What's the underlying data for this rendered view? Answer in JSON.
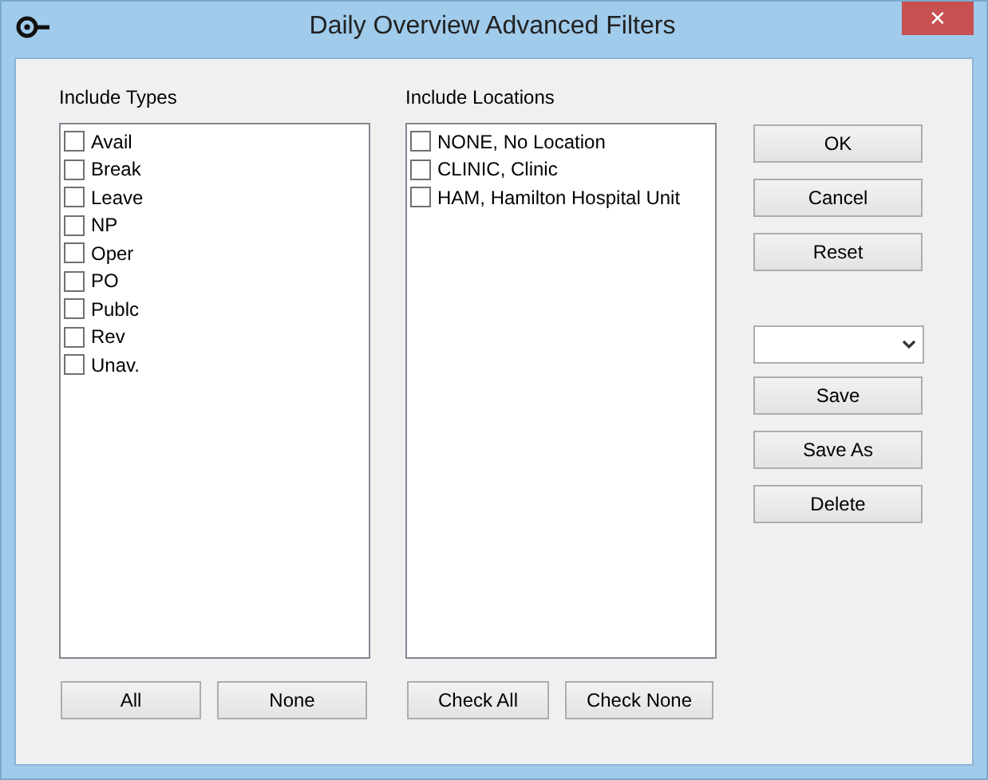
{
  "window": {
    "title": "Daily Overview Advanced Filters",
    "close": "✕"
  },
  "lists": [
    {
      "label": "Include Types",
      "items": [
        {
          "label": "Avail",
          "checked": false
        },
        {
          "label": "Break",
          "checked": false
        },
        {
          "label": "Leave",
          "checked": false
        },
        {
          "label": "NP",
          "checked": false
        },
        {
          "label": "Oper",
          "checked": false
        },
        {
          "label": "PO",
          "checked": false
        },
        {
          "label": "Publc",
          "checked": false
        },
        {
          "label": "Rev",
          "checked": false
        },
        {
          "label": "Unav.",
          "checked": false
        }
      ],
      "buttons": [
        "All",
        "None"
      ]
    },
    {
      "label": "Include Locations",
      "items": [
        {
          "label": "NONE, No Location",
          "checked": false
        },
        {
          "label": "CLINIC, Clinic",
          "checked": false
        },
        {
          "label": "HAM, Hamilton Hospital Unit",
          "checked": false
        }
      ],
      "buttons": [
        "Check All",
        "Check None"
      ]
    }
  ],
  "actions": [
    {
      "kind": "button",
      "label": "OK"
    },
    {
      "kind": "button",
      "label": "Cancel"
    },
    {
      "kind": "button",
      "label": "Reset"
    },
    {
      "kind": "dropdown"
    },
    {
      "kind": "button",
      "label": "Save"
    },
    {
      "kind": "button",
      "label": "Save As"
    },
    {
      "kind": "button",
      "label": "Delete"
    }
  ]
}
